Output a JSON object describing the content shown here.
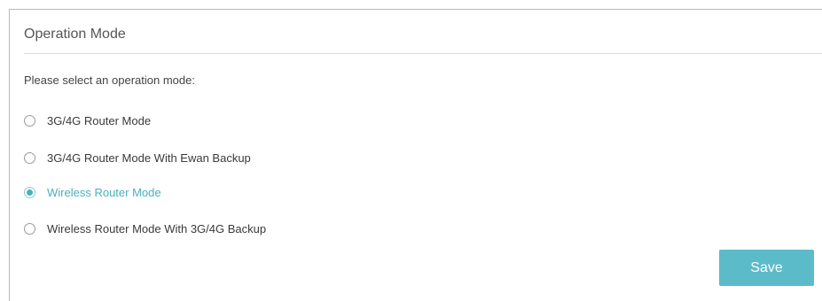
{
  "section": {
    "title": "Operation Mode",
    "prompt": "Please select an operation mode:"
  },
  "modes": [
    {
      "label": "3G/4G Router Mode",
      "selected": false
    },
    {
      "label": "3G/4G Router Mode With Ewan Backup",
      "selected": false
    },
    {
      "label": "Wireless Router Mode",
      "selected": true
    },
    {
      "label": "Wireless Router Mode With 3G/4G Backup",
      "selected": false
    }
  ],
  "actions": {
    "save_label": "Save"
  },
  "colors": {
    "accent": "#4ab0be",
    "button": "#5cbbc9",
    "border": "#b9b9b9"
  }
}
